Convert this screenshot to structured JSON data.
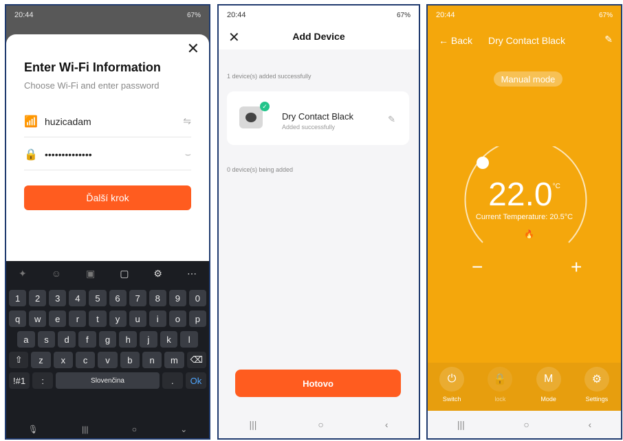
{
  "status": {
    "time": "20:44",
    "battery": "67%"
  },
  "wifi": {
    "title": "Enter Wi-Fi Information",
    "subtitle": "Choose Wi-Fi and enter password",
    "ssid": "huzicadam",
    "password": "••••••••••••••",
    "next": "Ďalší krok",
    "keyboard": {
      "numbers": [
        "1",
        "2",
        "3",
        "4",
        "5",
        "6",
        "7",
        "8",
        "9",
        "0"
      ],
      "row1": [
        "q",
        "w",
        "e",
        "r",
        "t",
        "y",
        "u",
        "i",
        "o",
        "p"
      ],
      "row2": [
        "a",
        "s",
        "d",
        "f",
        "g",
        "h",
        "j",
        "k",
        "l"
      ],
      "row3": [
        "z",
        "x",
        "c",
        "v",
        "b",
        "n",
        "m"
      ],
      "sym": "!#1",
      "colon": ":",
      "space": "Slovenčina",
      "dot": ".",
      "ok": "Ok"
    }
  },
  "add": {
    "title": "Add Device",
    "added": "1 device(s) added successfully",
    "device_name": "Dry Contact Black",
    "device_status": "Added successfully",
    "adding": "0 device(s) being added",
    "done": "Hotovo"
  },
  "thermo": {
    "back": "Back",
    "title": "Dry Contact Black",
    "mode": "Manual mode",
    "temp": "22.0",
    "unit": "°C",
    "current": "Current Temperature: 20.5°C",
    "buttons": [
      "Switch",
      "lock",
      "Mode",
      "Settings"
    ]
  }
}
